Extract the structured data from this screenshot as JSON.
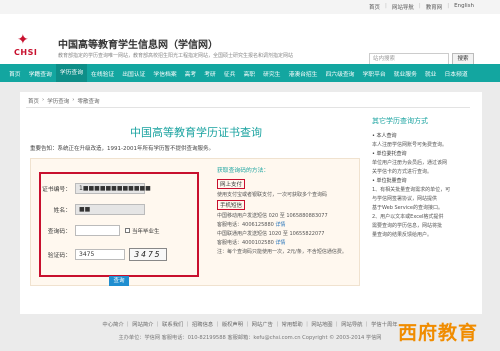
{
  "topbar": {
    "links": [
      "首页",
      "网站导航",
      "教育网",
      "English"
    ]
  },
  "header": {
    "brand": "CHSI",
    "title": "中国高等教育学生信息网（学信网）",
    "subtitle": "教育部指定的学历查询唯一网站，教育部高校招生阳光工程指定网站，全国硕士研究生报名和调剂指定网站",
    "search_placeholder": "站内搜索",
    "search_button": "搜索"
  },
  "nav": {
    "items": [
      "首页",
      "学籍查询",
      "学历查询",
      "在线验证",
      "出国认证",
      "学信档案",
      "高考",
      "考研",
      "征兵",
      "高职",
      "研究生",
      "港澳台招生",
      "四六级查询",
      "学职平台",
      "就业服务",
      "就业",
      "日本频道"
    ],
    "active_index": 2
  },
  "breadcrumb": [
    "首页",
    "›",
    "学历查询",
    "›",
    "零散查询"
  ],
  "main": {
    "title": "中国高等教育学历证书查询",
    "notice": "重要告知：系统正在升级改造，1991-2001年所有学历暂不提供查询服务。"
  },
  "form": {
    "cert_label": "证书编号：",
    "cert_value": "1■■■■■■■■■■■■",
    "name_label": "姓名：",
    "name_value": "■■",
    "query_code_label": "查询码：",
    "query_code_value": "",
    "graduate_label": "当年毕业生",
    "verify_label": "验证码：",
    "verify_value": "3475",
    "captcha_text": "3475",
    "submit": "查询"
  },
  "methods": {
    "title": "获取查询码的方法：",
    "online_head": "网上支付",
    "online_desc": "使用支付宝或者银联支付，一次可获取多个查询码",
    "mobile_head": "手机短信",
    "lines": [
      {
        "text": "中国移动用户发送短信 020 至 1065880883077"
      },
      {
        "text": "客服电话：4006125880",
        "link": "详情"
      },
      {
        "text": "中国联通用户发送短信 1020 至 10655822077"
      },
      {
        "text": "客服电话：4000102580",
        "link": "详情"
      },
      {
        "text": "注：每个查询码只能使用一次，2元/条，不含短信通信费。"
      }
    ]
  },
  "sidebar": {
    "title": "其它学历查询方式",
    "lines": [
      {
        "text": "• 本人查询",
        "head": true
      },
      {
        "text": "本人注册学信网账号可免费查询。"
      },
      {
        "text": ""
      },
      {
        "text": "• 单位委托查询",
        "head": true
      },
      {
        "text": "单位用户注册为会员后，通过该网"
      },
      {
        "text": "关学信卡的方式进行查询。"
      },
      {
        "text": ""
      },
      {
        "text": "• 单位批量查询",
        "head": true
      },
      {
        "text": "1、有相关批量查询需求的单位，可"
      },
      {
        "text": "与学信网签署协议，网站提供"
      },
      {
        "text": "基于Web Service的查询接口。"
      },
      {
        "text": "2、用户以文本或Excel格式提供"
      },
      {
        "text": "需要查询的学历信息，网站将批"
      },
      {
        "text": "量查询的结果反馈给用户。"
      }
    ]
  },
  "footer": {
    "links": "中心简介 ｜ 网站简介 ｜ 联系我们 ｜ 招聘信息 ｜ 版权声明 ｜ 网站广告 ｜ 常用帮助 ｜ 网站地图 ｜ 网站导航 ｜ 学信十周年",
    "copy": "主办单位：学信网    客服电话：010-82199588    客服邮箱：kefu@chsi.com.cn    Copyright © 2003-2014 学信网"
  },
  "watermark": "西府教育"
}
